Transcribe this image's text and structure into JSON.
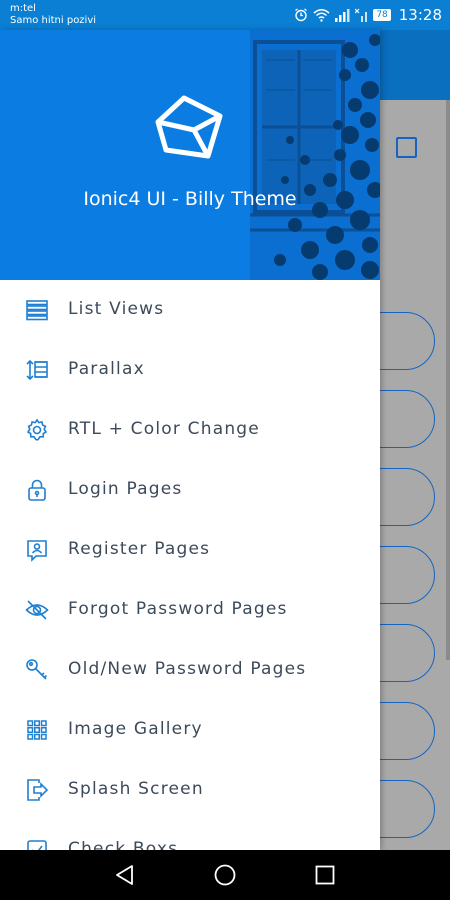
{
  "status_bar": {
    "carrier": "m:tel",
    "carrier_sub": "Samo hitni pozivi",
    "battery": "78",
    "time": "13:28",
    "icons": [
      "alarm-icon",
      "wifi-icon",
      "signal-icon",
      "signal-x-icon",
      "battery-icon"
    ]
  },
  "drawer": {
    "title": "Ionic4 UI - Billy Theme",
    "logo": "cube-logo",
    "items": [
      {
        "label": "List Views",
        "icon": "list-icon"
      },
      {
        "label": "Parallax",
        "icon": "parallax-icon"
      },
      {
        "label": "RTL + Color Change",
        "icon": "gear-icon"
      },
      {
        "label": "Login Pages",
        "icon": "lock-icon"
      },
      {
        "label": "Register Pages",
        "icon": "person-card-icon"
      },
      {
        "label": "Forgot Password Pages",
        "icon": "eye-off-icon"
      },
      {
        "label": "Old/New Password Pages",
        "icon": "key-icon"
      },
      {
        "label": "Image Gallery",
        "icon": "grid-icon"
      },
      {
        "label": "Splash Screen",
        "icon": "exit-icon"
      },
      {
        "label": "Check Boxs",
        "icon": "checkbox-icon"
      }
    ]
  },
  "colors": {
    "header_blue": "#0b7ce2",
    "icon_blue": "#1f7fd1",
    "label_text": "#3d4a5a",
    "overlay_grey": "#aeaeae"
  },
  "navbar": {
    "icons": [
      "back-icon",
      "home-icon",
      "recents-icon"
    ]
  }
}
